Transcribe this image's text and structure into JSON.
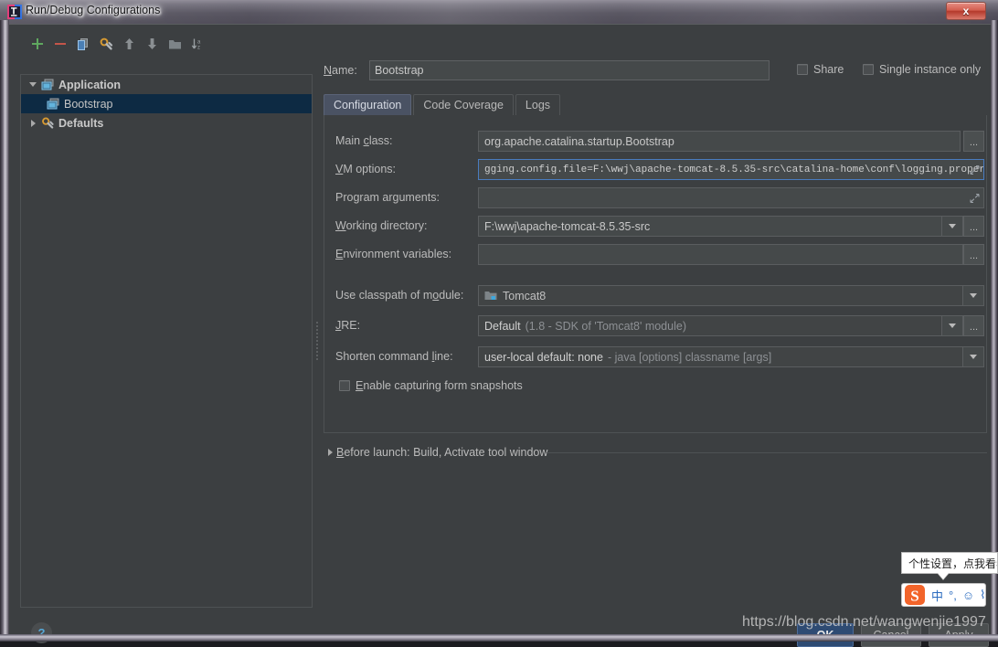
{
  "window": {
    "title": "Run/Debug Configurations",
    "app_icon": "intellij-idea-icon",
    "close_label": "x"
  },
  "toolbar": {
    "items": [
      {
        "name": "add-configuration-button",
        "icon": "plus-icon",
        "glyph": "+"
      },
      {
        "name": "remove-configuration-button",
        "icon": "minus-icon",
        "glyph": "−"
      },
      {
        "name": "copy-configuration-button",
        "icon": "copy-icon",
        "glyph": ""
      },
      {
        "name": "edit-templates-button",
        "icon": "wrench-icon",
        "glyph": ""
      },
      {
        "name": "move-up-button",
        "icon": "arrow-up-icon",
        "glyph": ""
      },
      {
        "name": "move-down-button",
        "icon": "arrow-down-icon",
        "glyph": ""
      },
      {
        "name": "create-folder-button",
        "icon": "folder-icon",
        "glyph": ""
      },
      {
        "name": "sort-alphabetically-button",
        "icon": "sort-az-icon",
        "glyph": ""
      }
    ]
  },
  "tree": {
    "rows": [
      {
        "label": "Application",
        "icon": "application-icon",
        "twisty": "down",
        "indent": 0,
        "selected": false,
        "bold": true
      },
      {
        "label": "Bootstrap",
        "icon": "application-icon",
        "twisty": "none",
        "indent": 1,
        "selected": true,
        "bold": false
      },
      {
        "label": "Defaults",
        "icon": "wrench-icon",
        "twisty": "right",
        "indent": 0,
        "selected": false,
        "bold": true
      }
    ]
  },
  "header": {
    "name_label": "Name:",
    "name_value": "Bootstrap",
    "share_label": "Share",
    "single_instance_label": "Single instance only"
  },
  "tabs": [
    {
      "label": "Configuration",
      "active": true
    },
    {
      "label": "Code Coverage",
      "active": false
    },
    {
      "label": "Logs",
      "active": false
    }
  ],
  "fields": {
    "main_class": {
      "label": "Main class:",
      "value": "org.apache.catalina.startup.Bootstrap",
      "ellipsis": "..."
    },
    "vm_options": {
      "label": "VM options:",
      "value": "gging.config.file=F:\\wwj\\apache-tomcat-8.5.35-src\\catalina-home\\conf\\logging.properties",
      "expand_icon": "expand-editor-icon"
    },
    "program_arguments": {
      "label": "Program arguments:",
      "value": "",
      "expand_icon": "expand-editor-icon"
    },
    "working_directory": {
      "label": "Working directory:",
      "value": "F:\\wwj\\apache-tomcat-8.5.35-src",
      "ellipsis": "..."
    },
    "environment_variables": {
      "label": "Environment variables:",
      "value": "",
      "ellipsis": "..."
    },
    "use_classpath_of_module": {
      "label": "Use classpath of module:",
      "value": "Tomcat8",
      "icon": "module-icon"
    },
    "jre": {
      "label": "JRE:",
      "value_strong": "Default",
      "value_dim": "(1.8 - SDK of 'Tomcat8' module)",
      "ellipsis": "..."
    },
    "shorten_command_line": {
      "label": "Shorten command line:",
      "value_strong": "user-local default: none",
      "value_dim": "- java [options] classname [args]"
    },
    "enable_capturing_form_snapshots": {
      "label": "Enable capturing form snapshots",
      "checked": false
    }
  },
  "before_launch": {
    "label": "Before launch: Build, Activate tool window",
    "twisty": "right"
  },
  "footer": {
    "help_label": "?",
    "ok_label": "OK",
    "cancel_label": "Cancel",
    "apply_label": "Apply"
  },
  "watermark": {
    "text": "https://blog.csdn.net/wangwenjie1997"
  },
  "ime": {
    "tooltip": "个性设置，点我看看",
    "logo": "sogou-pinyin-icon",
    "items": [
      {
        "name": "ime-mode-chinese",
        "label": "中"
      },
      {
        "name": "ime-punctuation-toggle",
        "label": "°,"
      },
      {
        "name": "ime-emoji-button",
        "label": "☺"
      },
      {
        "name": "ime-voice-button",
        "label": "⌇"
      }
    ]
  },
  "colors": {
    "dialog_bg": "#3c3f41",
    "field_bg": "#45494a",
    "selection_blue": "#0d2a43",
    "active_tab": "#4a5263",
    "ok_button": "#2e4b73",
    "focus_border": "#4a7cbf",
    "accent_green": "#58a858",
    "accent_red": "#c4554a"
  }
}
